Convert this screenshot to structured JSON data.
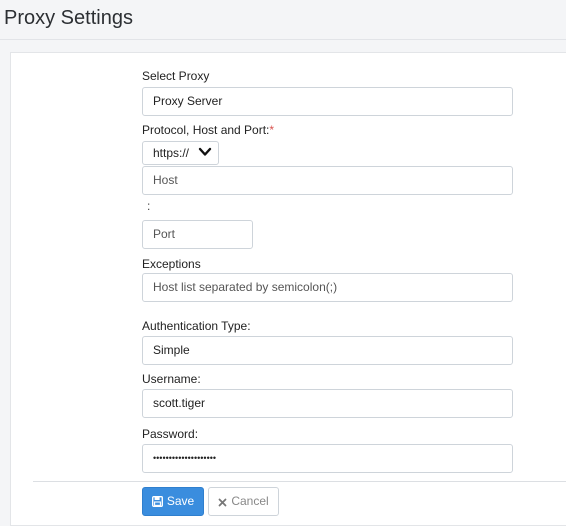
{
  "header": {
    "title": "Proxy Settings"
  },
  "form": {
    "select_proxy": {
      "label": "Select Proxy",
      "value": "Proxy Server"
    },
    "protocol": {
      "label": "Protocol, Host and Port:",
      "required_mark": "*",
      "selected": "https://",
      "host_placeholder": "Host",
      "separator": ":",
      "port_placeholder": "Port"
    },
    "exceptions": {
      "label": "Exceptions",
      "placeholder": "Host list separated by semicolon(;)"
    },
    "auth_type": {
      "label": "Authentication Type:",
      "value": "Simple"
    },
    "username": {
      "label": "Username:",
      "value": "scott.tiger"
    },
    "password": {
      "label": "Password:",
      "masked": "••••••••••••••••••••"
    }
  },
  "buttons": {
    "save": "Save",
    "cancel": "Cancel"
  },
  "colors": {
    "primary": "#3a8dde",
    "required": "#d9534f"
  }
}
